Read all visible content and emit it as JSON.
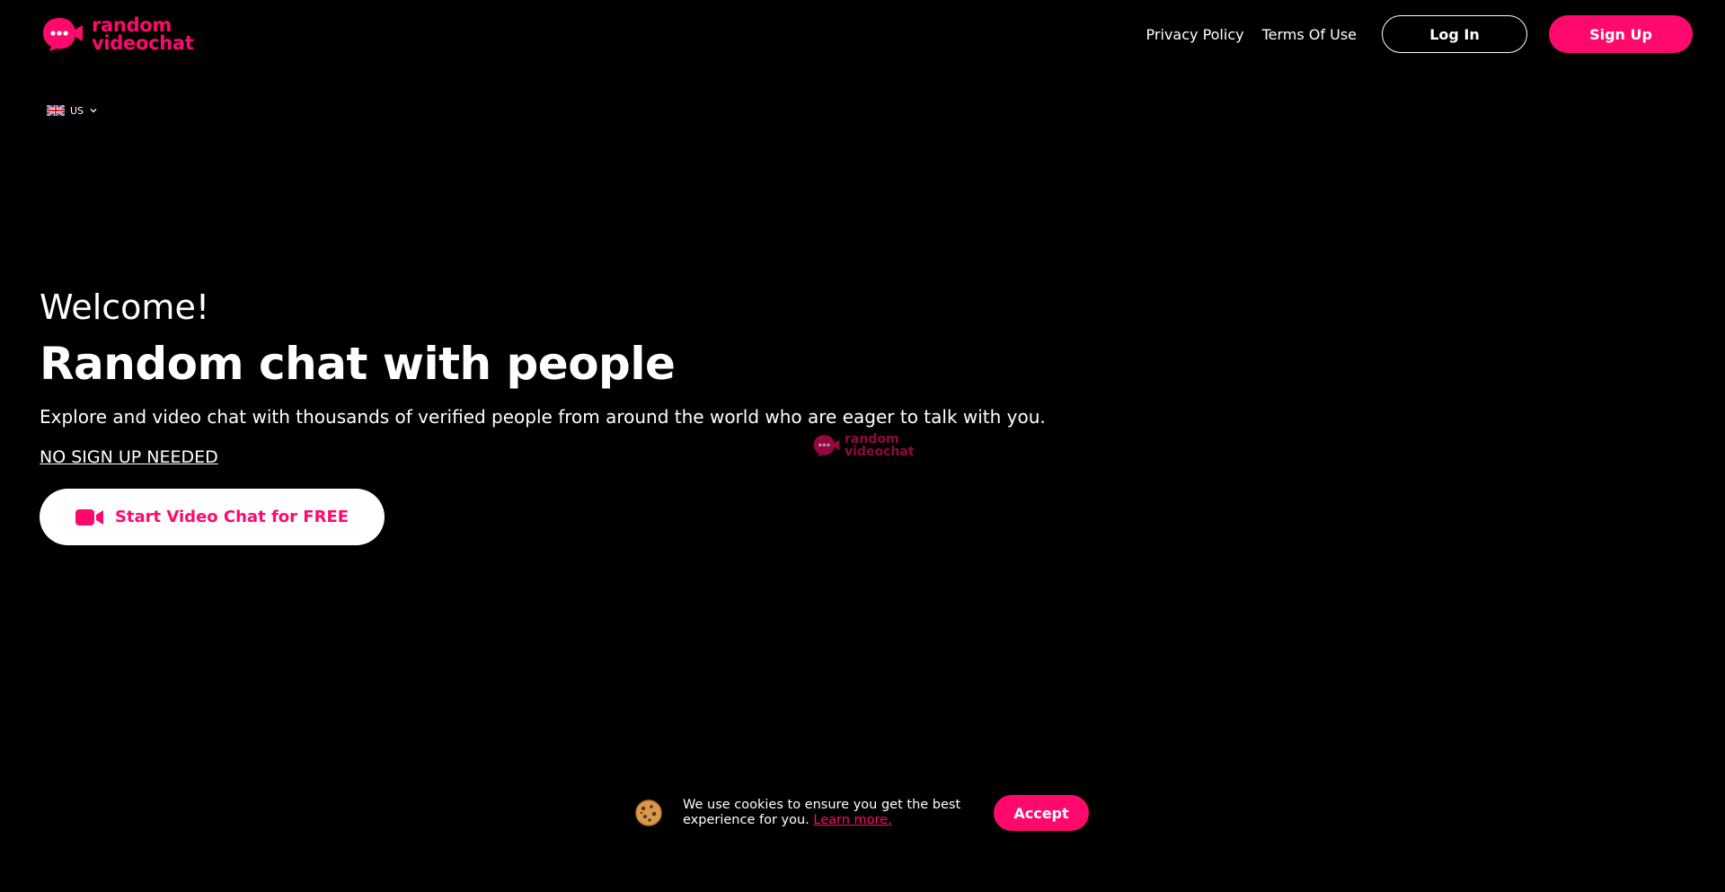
{
  "brand": {
    "name_line1": "random",
    "name_line2": "videochat",
    "accent_color": "#ff0a6c"
  },
  "header": {
    "nav": {
      "privacy_label": "Privacy Policy",
      "terms_label": "Terms Of Use"
    },
    "login_label": "Log In",
    "signup_label": "Sign Up"
  },
  "language": {
    "flag_icon": "uk-flag-icon",
    "code": "US",
    "dropdown_icon": "chevron-down-icon"
  },
  "hero": {
    "welcome": "Welcome!",
    "headline": "Random chat with people",
    "subtitle": "Explore and video chat with thousands of verified people from around the world who are eager to talk with you.",
    "no_signup": "NO SIGN UP NEEDED",
    "cta_icon": "video-camera-icon",
    "cta_label": "Start Video Chat for FREE"
  },
  "watermark": {
    "line1": "random",
    "line2": "videochat"
  },
  "cookie_banner": {
    "icon": "cookie-icon",
    "text": "We use cookies to ensure you get the best experience for you.",
    "link_label": "Learn more.",
    "accept_label": "Accept"
  }
}
